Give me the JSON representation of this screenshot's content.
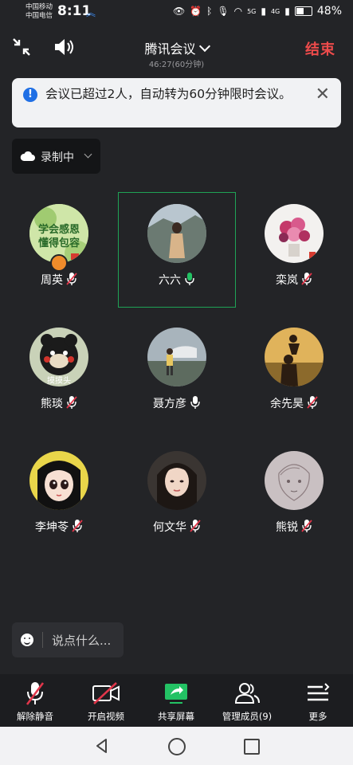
{
  "status_bar": {
    "carrier1": "中国移动",
    "carrier2": "中国电信",
    "time": "8:11",
    "network1": "5G",
    "network2": "4G",
    "battery": "48%"
  },
  "header": {
    "title": "腾讯会议",
    "timer": "46:27(60分钟)",
    "end_label": "结束"
  },
  "notice": {
    "text": "会议已超过2人，自动转为60分钟限时会议。",
    "icon": "info-icon",
    "close_icon": "close-icon"
  },
  "recording": {
    "label": "录制中"
  },
  "participants": [
    {
      "name": "周英",
      "mic": "muted",
      "avatar_caption": "学会感恩 懂得包容"
    },
    {
      "name": "六六",
      "mic": "speaking"
    },
    {
      "name": "栾岚",
      "mic": "muted"
    },
    {
      "name": "熊琰",
      "mic": "muted",
      "avatar_caption": "摸摸头"
    },
    {
      "name": "聂方彦",
      "mic": "on"
    },
    {
      "name": "余先昊",
      "mic": "muted"
    },
    {
      "name": "李坤苓",
      "mic": "muted"
    },
    {
      "name": "何文华",
      "mic": "muted"
    },
    {
      "name": "熊锐",
      "mic": "muted"
    }
  ],
  "chat": {
    "placeholder": "说点什么..."
  },
  "toolbar": {
    "unmute": "解除静音",
    "video": "开启视频",
    "share": "共享屏幕",
    "members": "管理成员(9)",
    "more": "更多"
  },
  "colors": {
    "background": "#232427",
    "end_red": "#ee4b4b",
    "speaking_green": "#1fa356",
    "muted_red": "#e0364a",
    "share_green": "#23c264",
    "notice_blue": "#1f6fe5"
  }
}
